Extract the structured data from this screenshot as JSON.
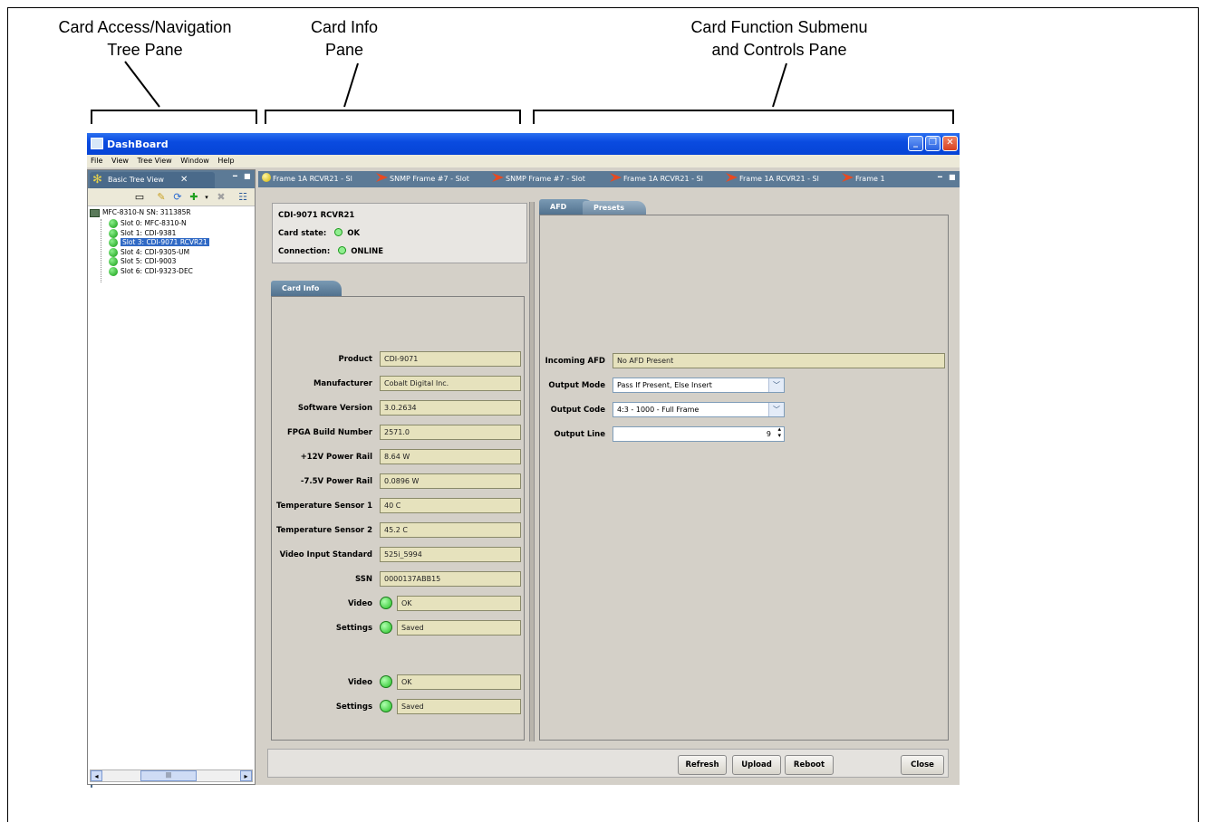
{
  "callouts": {
    "tree_pane": [
      "Card Access/Navigation",
      "Tree Pane"
    ],
    "info_pane": [
      "Card Info",
      "Pane"
    ],
    "function_pane": [
      "Card Function Submenu",
      "and Controls Pane"
    ]
  },
  "window": {
    "title": "DashBoard",
    "menu": [
      "File",
      "View",
      "Tree View",
      "Window",
      "Help"
    ],
    "controls": {
      "minimize": "_",
      "restore": "❐",
      "close": "✕"
    }
  },
  "tree_pane": {
    "tab_label": "Basic Tree View",
    "tab_close": "✕",
    "root": "MFC-8310-N SN: 311385R",
    "nodes": [
      {
        "label": "Slot 0: MFC-8310-N",
        "selected": false
      },
      {
        "label": "Slot 1: CDI-9381",
        "selected": false
      },
      {
        "label": "Slot 3: CDI-9071 RCVR21",
        "selected": true
      },
      {
        "label": "Slot 4: CDI-9305-UM",
        "selected": false
      },
      {
        "label": "Slot 5: CDI-9003",
        "selected": false
      },
      {
        "label": "Slot 6: CDI-9323-DEC",
        "selected": false
      }
    ],
    "scroll_thumb": "|||"
  },
  "card_tabs": [
    {
      "label": "Frame 1A RCVR21 - Sl",
      "icon": "yellow-dot-icon"
    },
    {
      "label": "SNMP Frame #7 - Slot",
      "icon": "card-arrow-icon"
    },
    {
      "label": "SNMP Frame #7 - Slot",
      "icon": "card-arrow-icon"
    },
    {
      "label": "Frame 1A RCVR21 - Sl",
      "icon": "card-arrow-icon"
    },
    {
      "label": "Frame 1A RCVR21 - Sl",
      "icon": "card-arrow-icon"
    },
    {
      "label": "Frame 1",
      "icon": "card-arrow-icon"
    }
  ],
  "card_info_header": {
    "card_name": "CDI-9071 RCVR21",
    "state_label": "Card state:",
    "state_value": "OK",
    "connection_label": "Connection:",
    "connection_value": "ONLINE"
  },
  "card_info_panel": {
    "tab": "Card Info",
    "fields": [
      {
        "label": "Product",
        "value": "CDI-9071"
      },
      {
        "label": "Manufacturer",
        "value": "Cobalt Digital Inc."
      },
      {
        "label": "Software Version",
        "value": "3.0.2634"
      },
      {
        "label": "FPGA Build Number",
        "value": "2571.0"
      },
      {
        "label": "+12V Power Rail",
        "value": "8.64 W"
      },
      {
        "label": "-7.5V Power Rail",
        "value": "0.0896 W"
      },
      {
        "label": "Temperature Sensor 1",
        "value": "40 C"
      },
      {
        "label": "Temperature Sensor 2",
        "value": "45.2 C"
      },
      {
        "label": "Video Input Standard",
        "value": "525i_5994"
      },
      {
        "label": "SSN",
        "value": "0000137ABB15"
      }
    ],
    "status_group_1": [
      {
        "label": "Video",
        "value": "OK"
      },
      {
        "label": "Settings",
        "value": "Saved"
      }
    ],
    "status_group_2": [
      {
        "label": "Video",
        "value": "OK"
      },
      {
        "label": "Settings",
        "value": "Saved"
      }
    ]
  },
  "function_panel": {
    "tabs": [
      "AFD",
      "Presets"
    ],
    "incoming_afd_label": "Incoming AFD",
    "incoming_afd_value": "No AFD Present",
    "output_mode_label": "Output Mode",
    "output_mode_value": "Pass If Present, Else Insert",
    "output_code_label": "Output Code",
    "output_code_value": "4:3 - 1000 - Full Frame",
    "output_line_label": "Output Line",
    "output_line_value": "9"
  },
  "buttons": {
    "refresh": "Refresh",
    "upload": "Upload",
    "reboot": "Reboot",
    "close": "Close"
  }
}
